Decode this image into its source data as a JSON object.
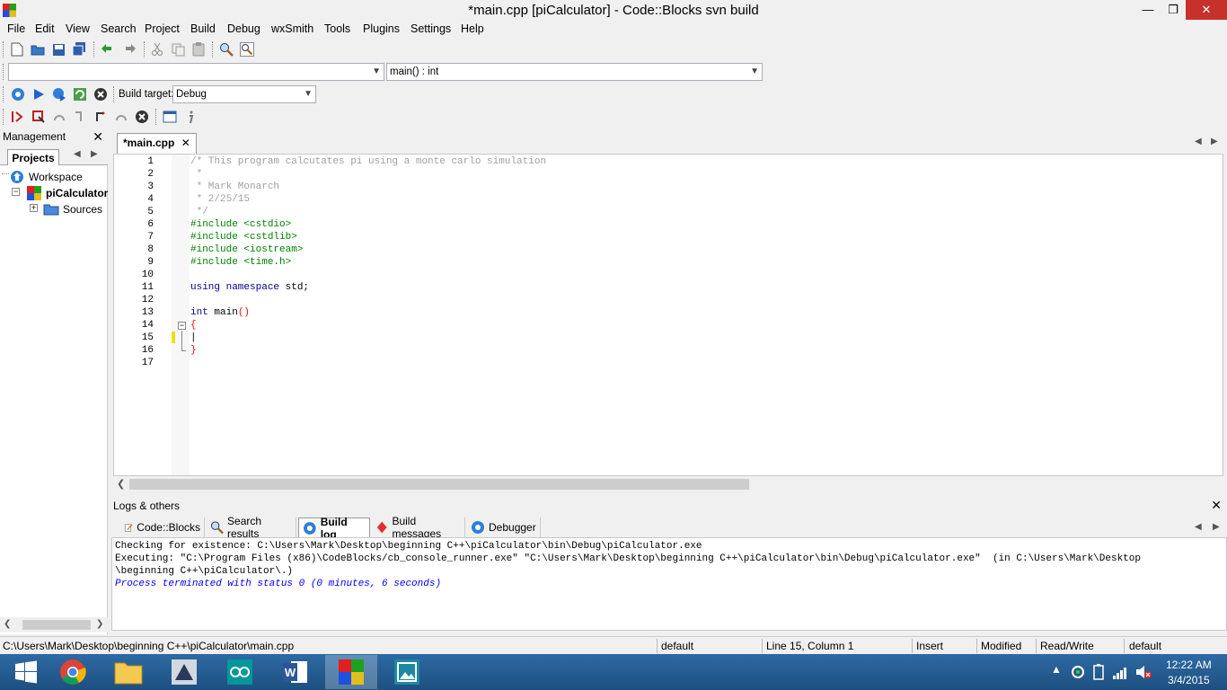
{
  "window": {
    "title": "*main.cpp [piCalculator] - Code::Blocks svn build",
    "minimize": "—",
    "maximize": "❐",
    "close": "✕"
  },
  "menu": [
    "File",
    "Edit",
    "View",
    "Search",
    "Project",
    "Build",
    "Debug",
    "wxSmith",
    "Tools",
    "Plugins",
    "Settings",
    "Help"
  ],
  "code_completion": {
    "scope_value": "",
    "function_value": "main() : int"
  },
  "build_toolbar": {
    "target_label": "Build target:",
    "target_value": "Debug"
  },
  "management": {
    "title": "Management",
    "tab": "Projects",
    "tree": {
      "workspace": "Workspace",
      "project": "piCalculator",
      "folder": "Sources"
    }
  },
  "editor": {
    "tab": "*main.cpp",
    "lines": [
      {
        "n": "1",
        "segs": [
          {
            "c": "cmt",
            "t": "/* This program calcutates pi using a monte carlo simulation"
          }
        ]
      },
      {
        "n": "2",
        "segs": [
          {
            "c": "cmt",
            "t": " *"
          }
        ]
      },
      {
        "n": "3",
        "segs": [
          {
            "c": "cmt",
            "t": " * Mark Monarch"
          }
        ]
      },
      {
        "n": "4",
        "segs": [
          {
            "c": "cmt",
            "t": " * 2/25/15"
          }
        ]
      },
      {
        "n": "5",
        "segs": [
          {
            "c": "cmt",
            "t": " */"
          }
        ]
      },
      {
        "n": "6",
        "segs": [
          {
            "c": "pp",
            "t": "#include <cstdio>"
          }
        ]
      },
      {
        "n": "7",
        "segs": [
          {
            "c": "pp",
            "t": "#include <cstdlib>"
          }
        ]
      },
      {
        "n": "8",
        "segs": [
          {
            "c": "pp",
            "t": "#include <iostream>"
          }
        ]
      },
      {
        "n": "9",
        "segs": [
          {
            "c": "pp",
            "t": "#include <time.h>"
          }
        ]
      },
      {
        "n": "10",
        "segs": []
      },
      {
        "n": "11",
        "segs": [
          {
            "c": "kw",
            "t": "using namespace"
          },
          {
            "c": "",
            "t": " std;"
          }
        ]
      },
      {
        "n": "12",
        "segs": []
      },
      {
        "n": "13",
        "segs": [
          {
            "c": "kw",
            "t": "int"
          },
          {
            "c": "",
            "t": " main"
          },
          {
            "c": "brk",
            "t": "()"
          }
        ]
      },
      {
        "n": "14",
        "segs": [
          {
            "c": "brk",
            "t": "{"
          }
        ]
      },
      {
        "n": "15",
        "segs": [
          {
            "c": "",
            "t": "|"
          }
        ]
      },
      {
        "n": "16",
        "segs": [
          {
            "c": "brk",
            "t": "}"
          }
        ]
      },
      {
        "n": "17",
        "segs": []
      }
    ]
  },
  "logs": {
    "title": "Logs & others",
    "tabs": [
      "Code::Blocks",
      "Search results",
      "Build log",
      "Build messages",
      "Debugger"
    ],
    "active_tab": "Build log",
    "lines": [
      {
        "c": "",
        "t": "Checking for existence: C:\\Users\\Mark\\Desktop\\beginning C++\\piCalculator\\bin\\Debug\\piCalculator.exe"
      },
      {
        "c": "",
        "t": "Executing: \"C:\\Program Files (x86)\\CodeBlocks/cb_console_runner.exe\" \"C:\\Users\\Mark\\Desktop\\beginning C++\\piCalculator\\bin\\Debug\\piCalculator.exe\"  (in C:\\Users\\Mark\\Desktop"
      },
      {
        "c": "",
        "t": "\\beginning C++\\piCalculator\\.)"
      },
      {
        "c": "ital",
        "t": "Process terminated with status 0 (0 minutes, 6 seconds)"
      }
    ]
  },
  "statusbar": {
    "path": "C:\\Users\\Mark\\Desktop\\beginning C++\\piCalculator\\main.cpp",
    "encoding": "default",
    "position": "Line 15, Column 1",
    "mode": "Insert",
    "modified": "Modified",
    "access": "Read/Write",
    "lang": "default"
  },
  "taskbar": {
    "time": "12:22 AM",
    "date": "3/4/2015"
  },
  "colors": {
    "comment": "#a0a0a0",
    "preprocessor": "#008000",
    "keyword": "#00008b",
    "brace": "#ff0000",
    "log_info": "#0000ff",
    "taskbar": "#1e4f80"
  }
}
